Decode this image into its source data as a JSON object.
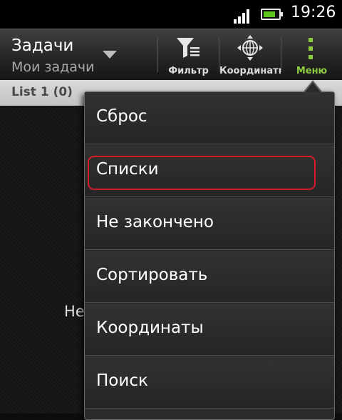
{
  "status_bar": {
    "time": "19:26",
    "battery_level": 0.8,
    "signal_bars": 4,
    "battery_color": "#5fc51c"
  },
  "action_bar": {
    "title": "Задачи",
    "subtitle": "Мои задачи",
    "buttons": [
      {
        "label": "Фильтр",
        "icon": "filter-icon"
      },
      {
        "label": "Координаты",
        "icon": "map-crosshair-icon"
      },
      {
        "label": "Меню",
        "icon": "overflow-menu-icon",
        "accent_color": "#8dcc3f"
      }
    ]
  },
  "list_header": {
    "title": "List 1 (0)"
  },
  "content": {
    "empty_text": "Не"
  },
  "menu": {
    "items": [
      {
        "label": "Сброс"
      },
      {
        "label": "Списки",
        "highlighted": true
      },
      {
        "label": "Не закончено"
      },
      {
        "label": "Сортировать"
      },
      {
        "label": "Координаты"
      },
      {
        "label": "Поиск"
      }
    ],
    "highlight_color": "#d51c28"
  }
}
